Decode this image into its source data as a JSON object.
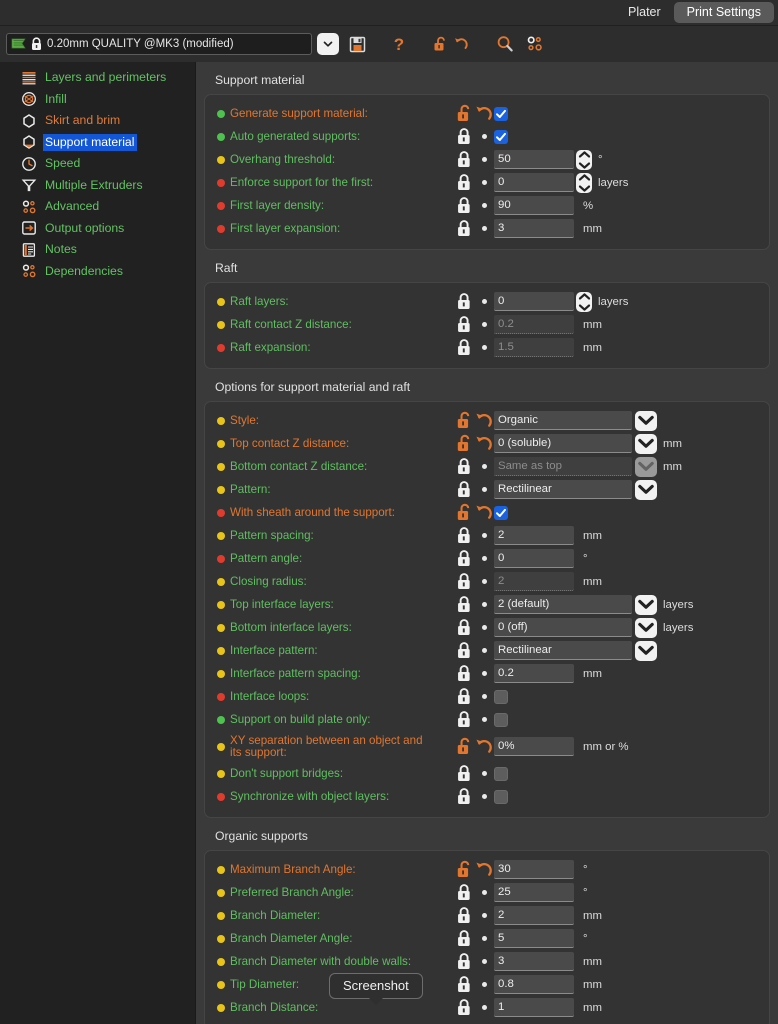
{
  "window": {
    "tabs": [
      {
        "label": "Plater",
        "active": false
      },
      {
        "label": "Print Settings",
        "active": true
      }
    ]
  },
  "toolbar": {
    "preset_value": "0.20mm QUALITY @MK3 (modified)",
    "preset_flag_icon": "green-flag-icon",
    "preset_lock_icon": "lock-closed-icon",
    "dropdown_icon": "chevron-down-icon",
    "save_icon": "save-icon",
    "help_icon": "question-mark-icon",
    "lock_icon": "lock-open-icon",
    "revert_icon": "revert-arrow-icon",
    "search_icon": "search-icon",
    "cog_icon": "gears-icon"
  },
  "sidebar": {
    "items": [
      {
        "label": "Layers and perimeters",
        "icon": "layers-icon",
        "color": "#63c264",
        "selected": false
      },
      {
        "label": "Infill",
        "icon": "infill-icon",
        "color": "#63c264",
        "selected": false
      },
      {
        "label": "Skirt and brim",
        "icon": "skirt-icon",
        "color": "#e07b39",
        "selected": false
      },
      {
        "label": "Support material",
        "icon": "support-icon",
        "color": "#ffffff",
        "selected": true
      },
      {
        "label": "Speed",
        "icon": "speed-icon",
        "color": "#63c264",
        "selected": false
      },
      {
        "label": "Multiple Extruders",
        "icon": "extruders-icon",
        "color": "#63c264",
        "selected": false
      },
      {
        "label": "Advanced",
        "icon": "gears-icon",
        "color": "#63c264",
        "selected": false
      },
      {
        "label": "Output options",
        "icon": "output-icon",
        "color": "#63c264",
        "selected": false
      },
      {
        "label": "Notes",
        "icon": "notes-icon",
        "color": "#63c264",
        "selected": false
      },
      {
        "label": "Dependencies",
        "icon": "gears-icon",
        "color": "#63c264",
        "selected": false
      }
    ]
  },
  "colors": {
    "label_default": "#5fbf60",
    "label_modified": "#e2762e",
    "bullet_green": "#4fc14f",
    "bullet_yellow": "#e8c419",
    "bullet_red": "#e03c2e",
    "accent_orange": "#e2762e",
    "checkbox_blue": "#1a62e0",
    "selection_blue": "#1457d6"
  },
  "groups": [
    {
      "title": "Support material",
      "rows": [
        {
          "label": "Generate support material:",
          "bullet": "green",
          "modified": true,
          "type": "checkbox",
          "checked": true,
          "unit": ""
        },
        {
          "label": "Auto generated supports:",
          "bullet": "green",
          "modified": false,
          "type": "checkbox",
          "checked": true,
          "unit": ""
        },
        {
          "label": "Overhang threshold:",
          "bullet": "yellow",
          "modified": false,
          "type": "spin",
          "value": "50",
          "unit": "°"
        },
        {
          "label": "Enforce support for the first:",
          "bullet": "red",
          "modified": false,
          "type": "spin",
          "value": "0",
          "unit": "layers"
        },
        {
          "label": "First layer density:",
          "bullet": "red",
          "modified": false,
          "type": "text",
          "value": "90",
          "unit": "%"
        },
        {
          "label": "First layer expansion:",
          "bullet": "red",
          "modified": false,
          "type": "text",
          "value": "3",
          "unit": "mm"
        }
      ]
    },
    {
      "title": "Raft",
      "rows": [
        {
          "label": "Raft layers:",
          "bullet": "yellow",
          "modified": false,
          "type": "spin",
          "value": "0",
          "unit": "layers"
        },
        {
          "label": "Raft contact Z distance:",
          "bullet": "yellow",
          "modified": false,
          "type": "text",
          "value": "0.2",
          "unit": "mm",
          "disabled": true
        },
        {
          "label": "Raft expansion:",
          "bullet": "red",
          "modified": false,
          "type": "text",
          "value": "1.5",
          "unit": "mm",
          "disabled": true
        }
      ]
    },
    {
      "title": "Options for support material and raft",
      "rows": [
        {
          "label": "Style:",
          "bullet": "yellow",
          "modified": true,
          "type": "combo",
          "value": "Organic",
          "unit": ""
        },
        {
          "label": "Top contact Z distance:",
          "bullet": "yellow",
          "modified": true,
          "type": "combo",
          "value": "0 (soluble)",
          "unit": "mm"
        },
        {
          "label": "Bottom contact Z distance:",
          "bullet": "yellow",
          "modified": false,
          "type": "combo",
          "value": "Same as top",
          "unit": "mm",
          "disabled": true
        },
        {
          "label": "Pattern:",
          "bullet": "yellow",
          "modified": false,
          "type": "combo",
          "value": "Rectilinear",
          "unit": ""
        },
        {
          "label": "With sheath around the support:",
          "bullet": "red",
          "modified": true,
          "type": "checkbox",
          "checked": true,
          "unit": ""
        },
        {
          "label": "Pattern spacing:",
          "bullet": "yellow",
          "modified": false,
          "type": "text",
          "value": "2",
          "unit": "mm"
        },
        {
          "label": "Pattern angle:",
          "bullet": "red",
          "modified": false,
          "type": "text",
          "value": "0",
          "unit": "°"
        },
        {
          "label": "Closing radius:",
          "bullet": "yellow",
          "modified": false,
          "type": "text",
          "value": "2",
          "unit": "mm",
          "disabled": true
        },
        {
          "label": "Top interface layers:",
          "bullet": "yellow",
          "modified": false,
          "type": "combo",
          "value": "2 (default)",
          "unit": "layers"
        },
        {
          "label": "Bottom interface layers:",
          "bullet": "yellow",
          "modified": false,
          "type": "combo",
          "value": "0 (off)",
          "unit": "layers"
        },
        {
          "label": "Interface pattern:",
          "bullet": "yellow",
          "modified": false,
          "type": "combo",
          "value": "Rectilinear",
          "unit": ""
        },
        {
          "label": "Interface pattern spacing:",
          "bullet": "yellow",
          "modified": false,
          "type": "text",
          "value": "0.2",
          "unit": "mm"
        },
        {
          "label": "Interface loops:",
          "bullet": "red",
          "modified": false,
          "type": "checkbox",
          "checked": false,
          "unit": ""
        },
        {
          "label": "Support on build plate only:",
          "bullet": "green",
          "modified": false,
          "type": "checkbox",
          "checked": false,
          "unit": ""
        },
        {
          "label": "XY separation between an object and its support:",
          "bullet": "yellow",
          "modified": true,
          "type": "text",
          "value": "0%",
          "unit": "mm or %",
          "twoline": true
        },
        {
          "label": "Don't support bridges:",
          "bullet": "yellow",
          "modified": false,
          "type": "checkbox",
          "checked": false,
          "unit": ""
        },
        {
          "label": "Synchronize with object layers:",
          "bullet": "red",
          "modified": false,
          "type": "checkbox",
          "checked": false,
          "unit": ""
        }
      ]
    },
    {
      "title": "Organic supports",
      "rows": [
        {
          "label": "Maximum Branch Angle:",
          "bullet": "yellow",
          "modified": true,
          "type": "text",
          "value": "30",
          "unit": "°"
        },
        {
          "label": "Preferred Branch Angle:",
          "bullet": "yellow",
          "modified": false,
          "type": "text",
          "value": "25",
          "unit": "°"
        },
        {
          "label": "Branch Diameter:",
          "bullet": "yellow",
          "modified": false,
          "type": "text",
          "value": "2",
          "unit": "mm"
        },
        {
          "label": "Branch Diameter Angle:",
          "bullet": "yellow",
          "modified": false,
          "type": "text",
          "value": "5",
          "unit": "°"
        },
        {
          "label": "Branch Diameter with double walls:",
          "bullet": "yellow",
          "modified": false,
          "type": "text",
          "value": "3",
          "unit": "mm"
        },
        {
          "label": "Tip Diameter:",
          "bullet": "yellow",
          "modified": false,
          "type": "text",
          "value": "0.8",
          "unit": "mm"
        },
        {
          "label": "Branch Distance:",
          "bullet": "yellow",
          "modified": false,
          "type": "text",
          "value": "1",
          "unit": "mm"
        }
      ]
    }
  ],
  "tooltip": {
    "text": "Screenshot"
  }
}
